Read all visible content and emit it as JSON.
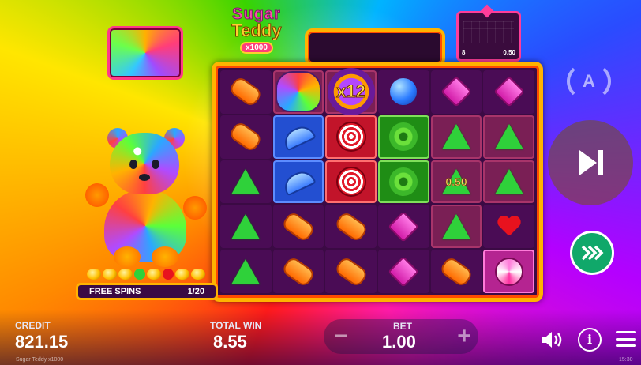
{
  "game": {
    "logo": {
      "line1": "Sugar",
      "line2": "Teddy",
      "line3": "x1000"
    },
    "mini_panel": {
      "left": "8",
      "right": "0.50"
    }
  },
  "reels": {
    "multiplier_label": "x12",
    "win_value": "0.50",
    "rows": [
      [
        "orange-candy",
        "rainbow-bear",
        "multiplier",
        "blue-ball",
        "pink-diamond",
        "pink-diamond"
      ],
      [
        "orange-candy",
        "blue-candy",
        "red-lollipop",
        "green-flower",
        "green-gumdrop",
        "green-gumdrop"
      ],
      [
        "green-gumdrop",
        "blue-candy",
        "red-lollipop",
        "green-flower",
        "green-gumdrop",
        "green-gumdrop"
      ],
      [
        "green-gumdrop",
        "orange-candy",
        "orange-candy",
        "pink-diamond",
        "green-gumdrop",
        "red-heart"
      ],
      [
        "green-gumdrop",
        "orange-candy",
        "orange-candy",
        "pink-diamond",
        "orange-candy",
        "pink-lollipop"
      ]
    ]
  },
  "free_spins": {
    "label": "FREE SPINS",
    "count": "1/20"
  },
  "controls": {
    "autoplay_label": "A",
    "credit_label": "CREDIT",
    "credit_value": "821.15",
    "total_win_label": "TOTAL WIN",
    "total_win_value": "8.55",
    "bet_label": "BET",
    "bet_value": "1.00",
    "bet_minus": "−",
    "bet_plus": "+",
    "info_label": "i"
  },
  "footer": {
    "left": "Sugar Teddy x1000",
    "right": "15:30"
  },
  "icons": [
    "autoplay-icon",
    "play-icon",
    "turbo-icon",
    "sound-icon",
    "info-icon",
    "menu-icon"
  ],
  "colors": {
    "frame": "#ffb300",
    "reel_bg": "#3b0a44",
    "turbo": "#10a86a"
  }
}
